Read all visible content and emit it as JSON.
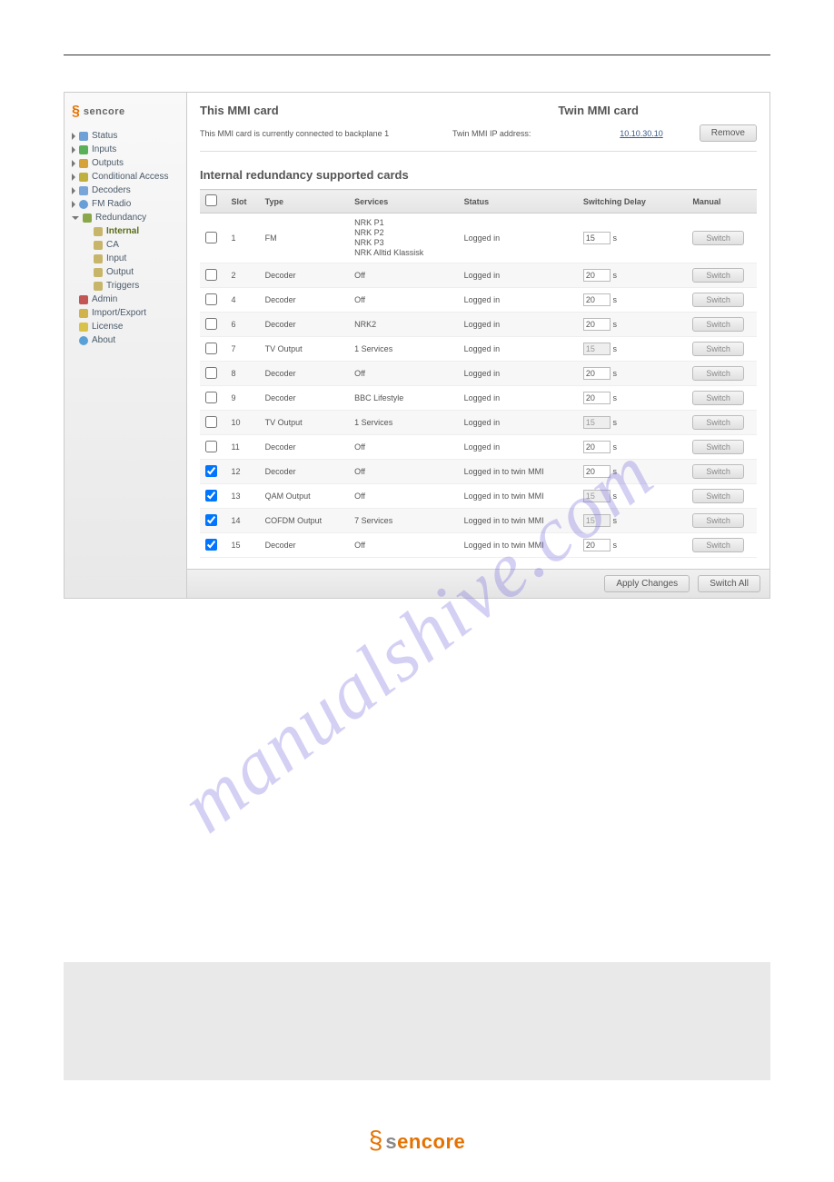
{
  "brand": "sencore",
  "watermark": "manualshive.com",
  "sidebar": {
    "items": [
      {
        "label": "Status",
        "icon": "ic-status",
        "tri": "r"
      },
      {
        "label": "Inputs",
        "icon": "ic-inputs",
        "tri": "r"
      },
      {
        "label": "Outputs",
        "icon": "ic-outputs",
        "tri": "r"
      },
      {
        "label": "Conditional Access",
        "icon": "ic-ca",
        "tri": "r"
      },
      {
        "label": "Decoders",
        "icon": "ic-dec",
        "tri": "r"
      },
      {
        "label": "FM Radio",
        "icon": "ic-fm",
        "tri": "r"
      },
      {
        "label": "Redundancy",
        "icon": "ic-red",
        "tri": "d"
      },
      {
        "label": "Internal",
        "icon": "ic-folder",
        "sub": true,
        "active": true
      },
      {
        "label": "CA",
        "icon": "ic-folder",
        "sub": true
      },
      {
        "label": "Input",
        "icon": "ic-folder",
        "sub": true
      },
      {
        "label": "Output",
        "icon": "ic-folder",
        "sub": true
      },
      {
        "label": "Triggers",
        "icon": "ic-folder",
        "sub": true
      },
      {
        "label": "Admin",
        "icon": "ic-admin"
      },
      {
        "label": "Import/Export",
        "icon": "ic-ie"
      },
      {
        "label": "License",
        "icon": "ic-lic"
      },
      {
        "label": "About",
        "icon": "ic-about"
      }
    ]
  },
  "header": {
    "this_title": "This MMI card",
    "twin_title": "Twin MMI card",
    "this_info": "This MMI card is currently connected to backplane 1",
    "twin_label": "Twin MMI IP address:",
    "twin_ip": "10.10.30.10",
    "remove_btn": "Remove"
  },
  "section_title": "Internal redundancy supported cards",
  "columns": {
    "slot": "Slot",
    "type": "Type",
    "services": "Services",
    "status": "Status",
    "delay": "Switching Delay",
    "manual": "Manual"
  },
  "delay_unit": "s",
  "switch_label": "Switch",
  "footer": {
    "apply": "Apply Changes",
    "switch_all": "Switch All"
  },
  "rows": [
    {
      "chk": false,
      "slot": "1",
      "type": "FM",
      "services": "NRK P1\nNRK P2\nNRK P3\nNRK Alltid Klassisk",
      "status": "Logged in",
      "delay": "15",
      "delay_disabled": false
    },
    {
      "chk": false,
      "slot": "2",
      "type": "Decoder",
      "services": "Off",
      "status": "Logged in",
      "delay": "20",
      "delay_disabled": false
    },
    {
      "chk": false,
      "slot": "4",
      "type": "Decoder",
      "services": "Off",
      "status": "Logged in",
      "delay": "20",
      "delay_disabled": false
    },
    {
      "chk": false,
      "slot": "6",
      "type": "Decoder",
      "services": "NRK2",
      "status": "Logged in",
      "delay": "20",
      "delay_disabled": false
    },
    {
      "chk": false,
      "slot": "7",
      "type": "TV Output",
      "services": "1 Services",
      "status": "Logged in",
      "delay": "15",
      "delay_disabled": true
    },
    {
      "chk": false,
      "slot": "8",
      "type": "Decoder",
      "services": "Off",
      "status": "Logged in",
      "delay": "20",
      "delay_disabled": false
    },
    {
      "chk": false,
      "slot": "9",
      "type": "Decoder",
      "services": "BBC Lifestyle",
      "status": "Logged in",
      "delay": "20",
      "delay_disabled": false
    },
    {
      "chk": false,
      "slot": "10",
      "type": "TV Output",
      "services": "1 Services",
      "status": "Logged in",
      "delay": "15",
      "delay_disabled": true
    },
    {
      "chk": false,
      "slot": "11",
      "type": "Decoder",
      "services": "Off",
      "status": "Logged in",
      "delay": "20",
      "delay_disabled": false
    },
    {
      "chk": true,
      "slot": "12",
      "type": "Decoder",
      "services": "Off",
      "status": "Logged in to twin MMI",
      "delay": "20",
      "delay_disabled": false
    },
    {
      "chk": true,
      "slot": "13",
      "type": "QAM Output",
      "services": "Off",
      "status": "Logged in to twin MMI",
      "delay": "15",
      "delay_disabled": true
    },
    {
      "chk": true,
      "slot": "14",
      "type": "COFDM Output",
      "services": "7 Services",
      "status": "Logged in to twin MMI",
      "delay": "15",
      "delay_disabled": true
    },
    {
      "chk": true,
      "slot": "15",
      "type": "Decoder",
      "services": "Off",
      "status": "Logged in to twin MMI",
      "delay": "20",
      "delay_disabled": false
    }
  ]
}
